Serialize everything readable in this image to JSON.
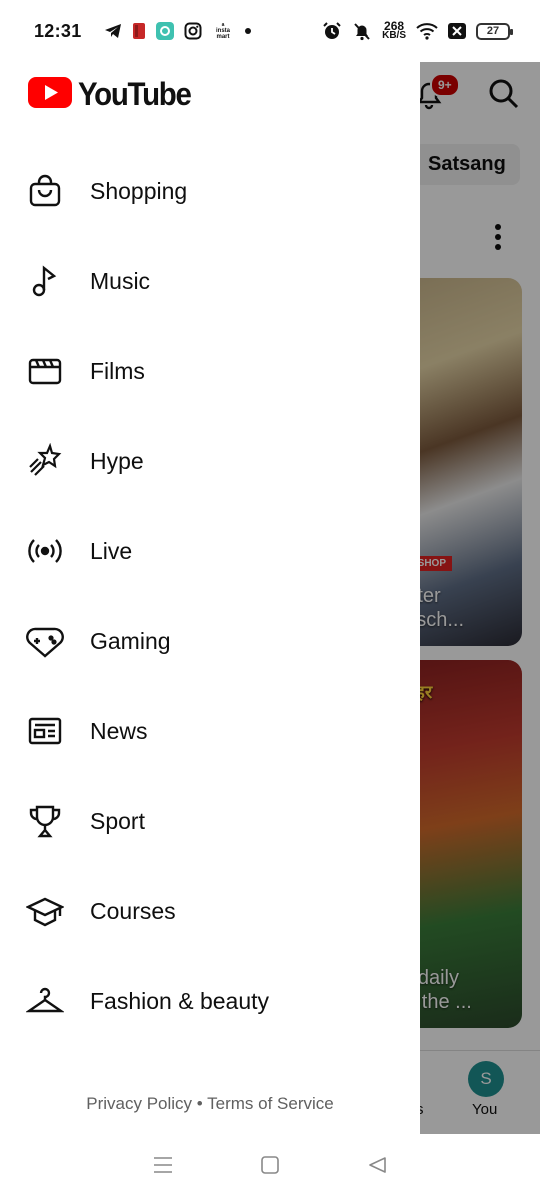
{
  "status_bar": {
    "time": "12:31",
    "speed_value": "268",
    "speed_unit": "KB/S",
    "battery": "27",
    "app_icons": [
      "telegram-icon",
      "red-app-icon",
      "teal-app-icon",
      "instagram-icon",
      "instamart-icon"
    ]
  },
  "background": {
    "chip_label": "Satsang",
    "notification_badge": "9+",
    "card1": {
      "tag": "ER AT SHOP",
      "title_line1": "ounter",
      "title_line2": "ts #sch..."
    },
    "card2": {
      "top_text": "ो बाहर",
      "title_line1": "w's daily",
      "title_line2": "n in the ..."
    },
    "bottom_nav": {
      "partial_label": "s",
      "you_avatar": "S",
      "you_label": "You"
    }
  },
  "drawer": {
    "logo_text": "YouTube",
    "brand_color": "#ff0000",
    "items": [
      {
        "label": "Shopping",
        "icon": "shopping-bag-icon"
      },
      {
        "label": "Music",
        "icon": "music-note-icon"
      },
      {
        "label": "Films",
        "icon": "clapperboard-icon"
      },
      {
        "label": "Hype",
        "icon": "shooting-star-icon"
      },
      {
        "label": "Live",
        "icon": "live-broadcast-icon"
      },
      {
        "label": "Gaming",
        "icon": "gamepad-heart-icon"
      },
      {
        "label": "News",
        "icon": "newspaper-icon"
      },
      {
        "label": "Sport",
        "icon": "trophy-icon"
      },
      {
        "label": "Courses",
        "icon": "graduation-cap-icon"
      },
      {
        "label": "Fashion & beauty",
        "icon": "hanger-icon"
      }
    ],
    "footer": {
      "privacy": "Privacy Policy",
      "separator": "•",
      "terms": "Terms of Service"
    }
  }
}
